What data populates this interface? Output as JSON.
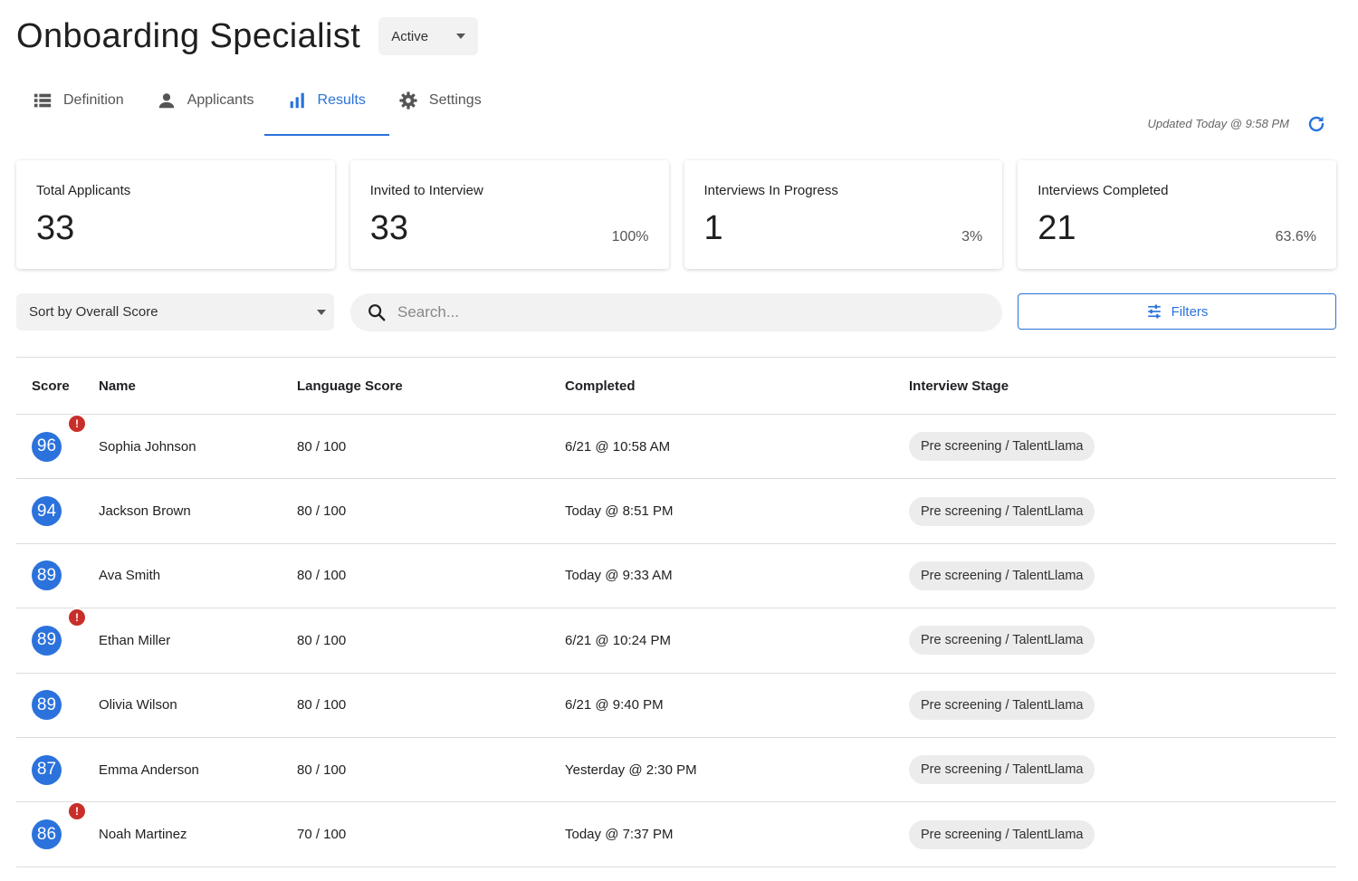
{
  "header": {
    "title": "Onboarding Specialist",
    "status": "Active"
  },
  "tabs": [
    {
      "label": "Definition",
      "icon": "list-icon"
    },
    {
      "label": "Applicants",
      "icon": "person-icon"
    },
    {
      "label": "Results",
      "icon": "bar-chart-icon",
      "active": true
    },
    {
      "label": "Settings",
      "icon": "gear-icon"
    }
  ],
  "updated": "Updated Today @ 9:58 PM",
  "stats": [
    {
      "label": "Total Applicants",
      "value": "33",
      "pct": ""
    },
    {
      "label": "Invited to Interview",
      "value": "33",
      "pct": "100%"
    },
    {
      "label": "Interviews In Progress",
      "value": "1",
      "pct": "3%"
    },
    {
      "label": "Interviews Completed",
      "value": "21",
      "pct": "63.6%"
    }
  ],
  "controls": {
    "sort": "Sort by Overall Score",
    "search_placeholder": "Search...",
    "filters": "Filters"
  },
  "table": {
    "columns": [
      "Score",
      "Name",
      "Language Score",
      "Completed",
      "Interview Stage"
    ],
    "rows": [
      {
        "score": "96",
        "alert": true,
        "name": "Sophia Johnson",
        "language": "80 / 100",
        "completed": "6/21 @ 10:58 AM",
        "stage": "Pre screening / TalentLlama"
      },
      {
        "score": "94",
        "alert": false,
        "name": "Jackson Brown",
        "language": "80 / 100",
        "completed": "Today @ 8:51 PM",
        "stage": "Pre screening / TalentLlama"
      },
      {
        "score": "89",
        "alert": false,
        "name": "Ava Smith",
        "language": "80 / 100",
        "completed": "Today @ 9:33 AM",
        "stage": "Pre screening / TalentLlama"
      },
      {
        "score": "89",
        "alert": true,
        "name": "Ethan Miller",
        "language": "80 / 100",
        "completed": "6/21 @ 10:24 PM",
        "stage": "Pre screening / TalentLlama"
      },
      {
        "score": "89",
        "alert": false,
        "name": "Olivia Wilson",
        "language": "80 / 100",
        "completed": "6/21 @ 9:40 PM",
        "stage": "Pre screening / TalentLlama"
      },
      {
        "score": "87",
        "alert": false,
        "name": "Emma Anderson",
        "language": "80 / 100",
        "completed": "Yesterday @ 2:30 PM",
        "stage": "Pre screening / TalentLlama"
      },
      {
        "score": "86",
        "alert": true,
        "name": "Noah Martinez",
        "language": "70 / 100",
        "completed": "Today @ 7:37 PM",
        "stage": "Pre screening / TalentLlama"
      }
    ]
  },
  "colors": {
    "accent": "#2a73d9",
    "score_badge": "#2b72dc",
    "alert": "#c92f2a"
  }
}
